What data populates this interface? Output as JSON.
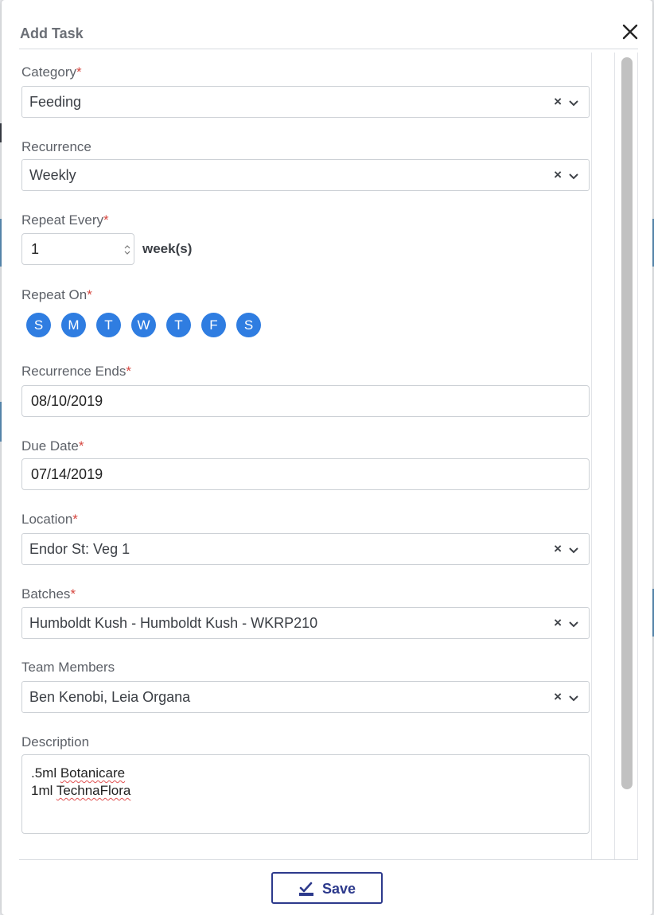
{
  "modal": {
    "title": "Add Task",
    "save_label": "Save"
  },
  "fields": {
    "category": {
      "label": "Category",
      "required_mark": "*",
      "value": "Feeding"
    },
    "recurrence": {
      "label": "Recurrence",
      "value": "Weekly"
    },
    "repeat_every": {
      "label": "Repeat Every",
      "required_mark": "*",
      "value": "1",
      "unit": "week(s)"
    },
    "repeat_on": {
      "label": "Repeat On",
      "required_mark": "*",
      "days": [
        "S",
        "M",
        "T",
        "W",
        "T",
        "F",
        "S"
      ]
    },
    "recurrence_ends": {
      "label": "Recurrence Ends",
      "required_mark": "*",
      "value": "08/10/2019"
    },
    "due_date": {
      "label": "Due Date",
      "required_mark": "*",
      "value": "07/14/2019"
    },
    "location": {
      "label": "Location",
      "required_mark": "*",
      "value": "Endor St: Veg 1"
    },
    "batches": {
      "label": "Batches",
      "required_mark": "*",
      "value": "Humboldt Kush - Humboldt Kush - WKRP210"
    },
    "team_members": {
      "label": "Team Members",
      "value": "Ben Kenobi, Leia Organa"
    },
    "description": {
      "label": "Description",
      "line1_prefix": ".5ml ",
      "line1_word": "Botanicare",
      "line2_prefix": "1ml ",
      "line2_word": "TechnaFlora"
    }
  },
  "icons": {
    "close": "close-icon",
    "clear": "×",
    "chevron": "chevron-down-icon",
    "save": "save-check-icon"
  },
  "colors": {
    "accent": "#2f7de1",
    "required": "#d6463f",
    "save_button": "#2d3a8c"
  }
}
